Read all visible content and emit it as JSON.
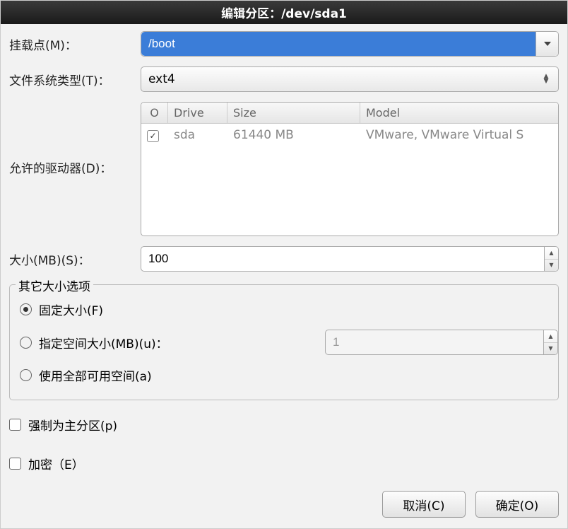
{
  "window": {
    "title": "编辑分区：/dev/sda1"
  },
  "mountPoint": {
    "label": "挂载点(M)：",
    "value": "/boot"
  },
  "fsType": {
    "label": "文件系统类型(T)：",
    "value": "ext4"
  },
  "drives": {
    "label": "允许的驱动器(D)：",
    "headers": {
      "check": "O",
      "drive": "Drive",
      "size": "Size",
      "model": "Model"
    },
    "rows": [
      {
        "checked": true,
        "drive": "sda",
        "size": "61440 MB",
        "model": "VMware, VMware Virtual S"
      }
    ]
  },
  "size": {
    "label": "大小(MB)(S)：",
    "value": "100"
  },
  "sizeOptions": {
    "legend": "其它大小选项",
    "fixed": "固定大小(F)",
    "specify": "指定空间大小(MB)(u)：",
    "specifyValue": "1",
    "fill": "使用全部可用空间(a)"
  },
  "forcePrimary": {
    "label": "强制为主分区(p)"
  },
  "encrypt": {
    "label": "加密（E）"
  },
  "buttons": {
    "cancel": "取消(C)",
    "ok": "确定(O)"
  }
}
